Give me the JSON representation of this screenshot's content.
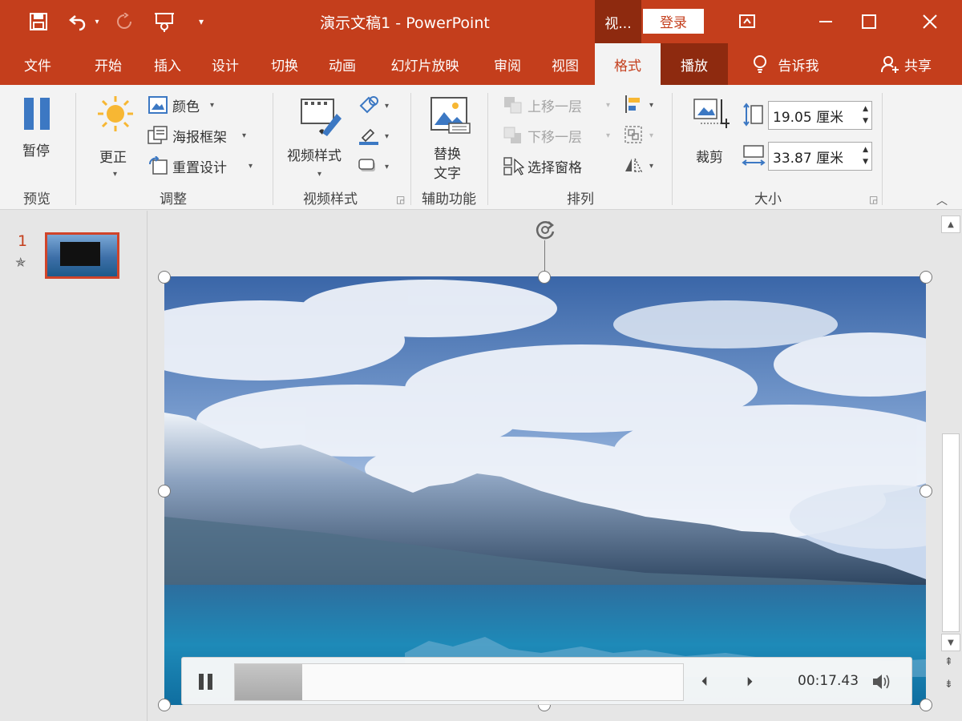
{
  "titlebar": {
    "doc_title": "演示文稿1  -  PowerPoint",
    "context_tab": "视...",
    "login": "登录"
  },
  "tabs": [
    {
      "label": "文件"
    },
    {
      "label": "开始"
    },
    {
      "label": "插入"
    },
    {
      "label": "设计"
    },
    {
      "label": "切换"
    },
    {
      "label": "动画"
    },
    {
      "label": "幻灯片放映"
    },
    {
      "label": "审阅"
    },
    {
      "label": "视图"
    },
    {
      "label": "格式"
    },
    {
      "label": "播放"
    },
    {
      "label": "告诉我"
    },
    {
      "label": "共享"
    }
  ],
  "ribbon": {
    "preview": {
      "pause": "暂停",
      "label": "预览"
    },
    "adjust": {
      "correct": "更正",
      "color": "颜色",
      "poster": "海报框架",
      "reset": "重置设计",
      "label": "调整"
    },
    "video_styles": {
      "styles": "视频样式",
      "label": "视频样式"
    },
    "accessibility": {
      "alt_line1": "替换",
      "alt_line2": "文字",
      "label": "辅助功能"
    },
    "arrange": {
      "bring_forward": "上移一层",
      "send_backward": "下移一层",
      "selection_pane": "选择窗格",
      "label": "排列"
    },
    "size": {
      "crop": "裁剪",
      "height": "19.05 厘米",
      "width": "33.87 厘米",
      "label": "大小"
    }
  },
  "slides_pane": {
    "slide_number": "1"
  },
  "player": {
    "time": "00:17.43",
    "progress": 0.15
  }
}
